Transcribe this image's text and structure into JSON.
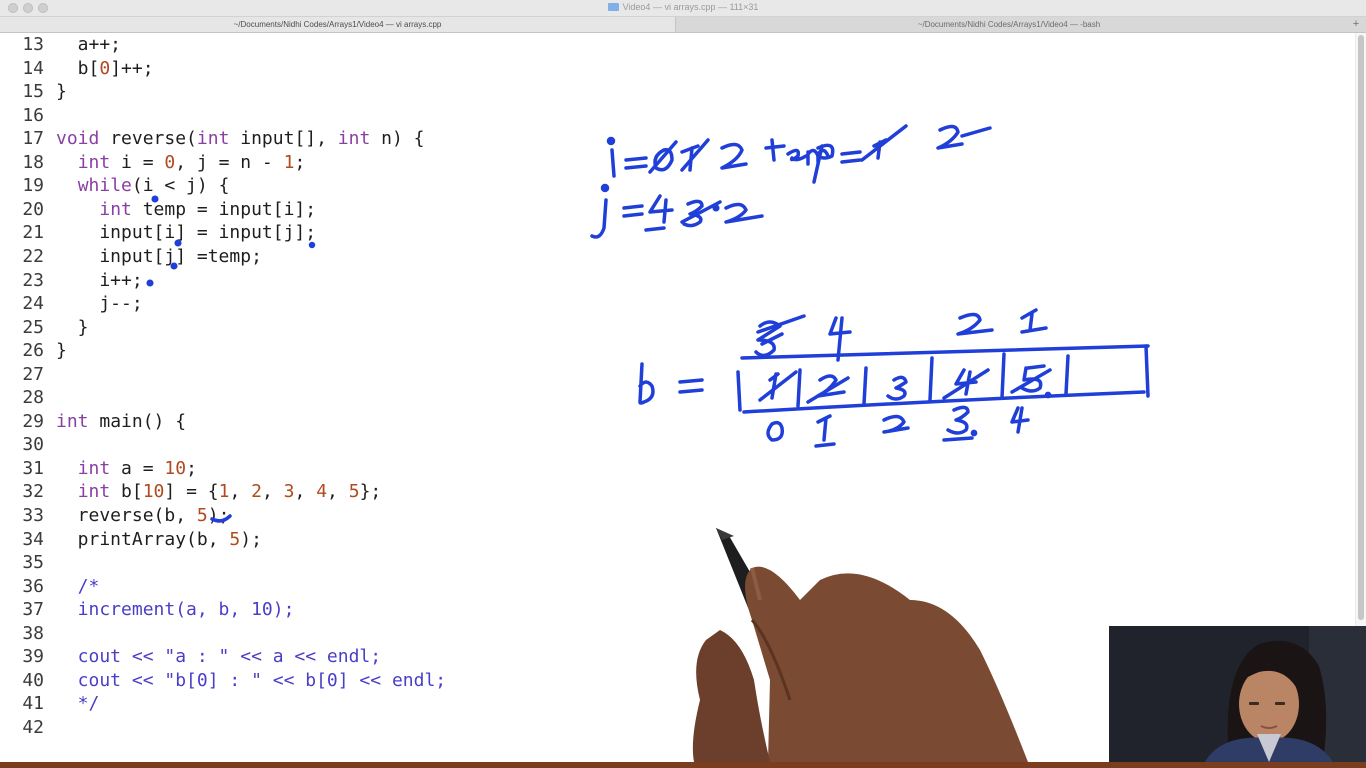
{
  "window": {
    "title": "Video4 — vi arrays.cpp — 111×31",
    "tabs": [
      {
        "label": "~/Documents/Nidhi Codes/Arrays1/Video4 — vi arrays.cpp",
        "active": true
      },
      {
        "label": "~/Documents/Nidhi Codes/Arrays1/Video4 — -bash",
        "active": false
      }
    ],
    "new_tab_label": "+"
  },
  "editor": {
    "lines": [
      {
        "n": "13",
        "text": "  a++;"
      },
      {
        "n": "14",
        "text": "  b[0]++;"
      },
      {
        "n": "15",
        "text": "}"
      },
      {
        "n": "16",
        "text": ""
      },
      {
        "n": "17",
        "text": "void reverse(int input[], int n) {"
      },
      {
        "n": "18",
        "text": "  int i = 0, j = n - 1;"
      },
      {
        "n": "19",
        "text": "  while(i < j) {"
      },
      {
        "n": "20",
        "text": "    int temp = input[i];"
      },
      {
        "n": "21",
        "text": "    input[i] = input[j];"
      },
      {
        "n": "22",
        "text": "    input[j] =temp;"
      },
      {
        "n": "23",
        "text": "    i++;"
      },
      {
        "n": "24",
        "text": "    j--;"
      },
      {
        "n": "25",
        "text": "  }"
      },
      {
        "n": "26",
        "text": "}"
      },
      {
        "n": "27",
        "text": ""
      },
      {
        "n": "28",
        "text": ""
      },
      {
        "n": "29",
        "text": "int main() {"
      },
      {
        "n": "30",
        "text": ""
      },
      {
        "n": "31",
        "text": "  int a = 10;"
      },
      {
        "n": "32",
        "text": "  int b[10] = {1, 2, 3, 4, 5};"
      },
      {
        "n": "33",
        "text": "  reverse(b, 5);"
      },
      {
        "n": "34",
        "text": "  printArray(b, 5);"
      },
      {
        "n": "35",
        "text": ""
      },
      {
        "n": "36",
        "text": "  /*"
      },
      {
        "n": "37",
        "text": "  increment(a, b, 10);"
      },
      {
        "n": "38",
        "text": ""
      },
      {
        "n": "39",
        "text": "  cout << \"a : \" << a << endl;"
      },
      {
        "n": "40",
        "text": "  cout << \"b[0] : \" << b[0] << endl;"
      },
      {
        "n": "41",
        "text": "  */"
      },
      {
        "n": "42",
        "text": ""
      }
    ]
  },
  "annotations": {
    "color": "#1f3fd8",
    "i_label": "i",
    "i_values": "= 0 1 2",
    "temp_label": "temp",
    "temp_values": "= 1 2",
    "j_label": "j",
    "j_values": "= 4 3 2",
    "array_name": "b",
    "array_cells": [
      "1",
      "2",
      "3",
      "4",
      "5",
      "",
      ""
    ],
    "array_new_values": [
      "5",
      "4",
      "",
      "2",
      "1"
    ],
    "array_indices": [
      "0",
      "1",
      "2",
      "3",
      "4"
    ]
  },
  "colors": {
    "keyword": "#8a3fa3",
    "number": "#b04a1f",
    "comment": "#4a3ec7",
    "ink": "#1f3fd8"
  }
}
